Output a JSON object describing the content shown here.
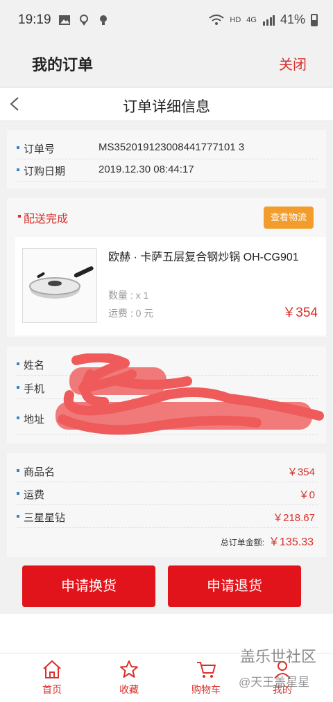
{
  "status_bar": {
    "time": "19:19",
    "network": "HD",
    "network2": "4G",
    "battery": "41%"
  },
  "header": {
    "title": "我的订单",
    "close": "关闭"
  },
  "subheader": {
    "title": "订单详细信息"
  },
  "order_info": {
    "order_no_label": "订单号",
    "order_no": "MS352019123008441777101 3",
    "date_label": "订购日期",
    "date": "2019.12.30 08:44:17"
  },
  "delivery": {
    "status": "配送完成",
    "logistics_button": "查看物流",
    "product_name": "欧赫 · 卡萨五层复合钢炒锅 OH-CG901",
    "quantity": "数量 : x 1",
    "shipping": "运费 : 0 元",
    "price": "￥354"
  },
  "recipient": {
    "name_label": "姓名",
    "phone_label": "手机",
    "address_label": "地址"
  },
  "summary": {
    "product_label": "商品名",
    "product_value": "￥354",
    "freight_label": "运费",
    "freight_value": "￥0",
    "diamond_label": "三星星钻",
    "diamond_value": "￥218.67",
    "total_label": "总订单金额:",
    "total_value": "￥135.33"
  },
  "actions": {
    "exchange": "申请换货",
    "refund": "申请退货"
  },
  "tabs": [
    {
      "label": "首页",
      "icon": "home-icon"
    },
    {
      "label": "收藏",
      "icon": "star-icon"
    },
    {
      "label": "购物车",
      "icon": "cart-icon"
    },
    {
      "label": "我的",
      "icon": "user-icon"
    }
  ],
  "watermark": {
    "line1": "盖乐世社区",
    "line2": "@天王盖星星"
  },
  "colors": {
    "accent": "#e2141b",
    "logistics": "#f29d2b",
    "dot": "#3b82c4"
  }
}
